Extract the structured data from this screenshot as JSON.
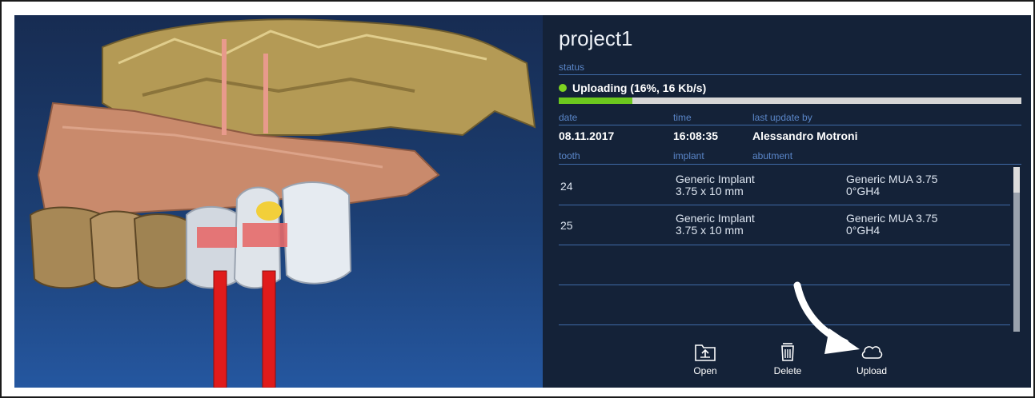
{
  "project": {
    "title": "project1"
  },
  "status": {
    "label": "status",
    "text": "Uploading (16%, 16 Kb/s)",
    "progress": 0.16,
    "indicator_color": "#7ed321"
  },
  "meta": {
    "date_label": "date",
    "time_label": "time",
    "updated_by_label": "last update by",
    "date": "08.11.2017",
    "time": "16:08:35",
    "updated_by": "Alessandro Motroni"
  },
  "table": {
    "headers": {
      "tooth": "tooth",
      "implant": "implant",
      "abutment": "abutment"
    },
    "rows": [
      {
        "tooth": "24",
        "implant_name": "Generic Implant",
        "implant_size": "3.75 x 10 mm",
        "abutment_name": "Generic MUA 3.75",
        "abutment_spec": "0°GH4"
      },
      {
        "tooth": "25",
        "implant_name": "Generic Implant",
        "implant_size": "3.75 x 10 mm",
        "abutment_name": "Generic MUA 3.75",
        "abutment_spec": "0°GH4"
      }
    ]
  },
  "toolbar": {
    "open": {
      "label": "Open",
      "icon": "folder-upload-icon"
    },
    "delete": {
      "label": "Delete",
      "icon": "trash-icon"
    },
    "upload": {
      "label": "Upload",
      "icon": "cloud-icon"
    }
  },
  "colors": {
    "panel_bg": "#142238",
    "accent": "#3f6aa6",
    "progress": "#6cc81e"
  }
}
